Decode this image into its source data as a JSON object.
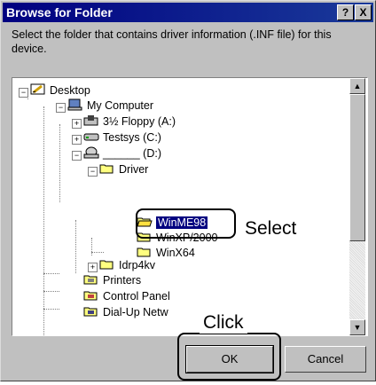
{
  "window": {
    "title": "Browse for Folder",
    "help_label": "?",
    "close_label": "X"
  },
  "description": "Select the folder that contains driver information (.INF file) for this device.",
  "tree": {
    "desktop": "Desktop",
    "my_computer": "My Computer",
    "floppy": "3½ Floppy (A:)",
    "testsys": "Testsys (C:)",
    "cd_drive": "______ (D:)",
    "driver": "Driver",
    "winme98": "WinME98",
    "win2000_partial": "WinXP/2000",
    "winx64": "WinX64",
    "idrp4kv": "Idrp4kv",
    "printers": "Printers",
    "control_panel": "Control Panel",
    "dialup": "Dial-Up Netw",
    "plus": "+",
    "minus": "−"
  },
  "scrollbar": {
    "up_arrow": "▲",
    "down_arrow": "▼"
  },
  "buttons": {
    "ok": "OK",
    "cancel": "Cancel"
  },
  "callouts": {
    "select": "Select",
    "click": "Click"
  }
}
